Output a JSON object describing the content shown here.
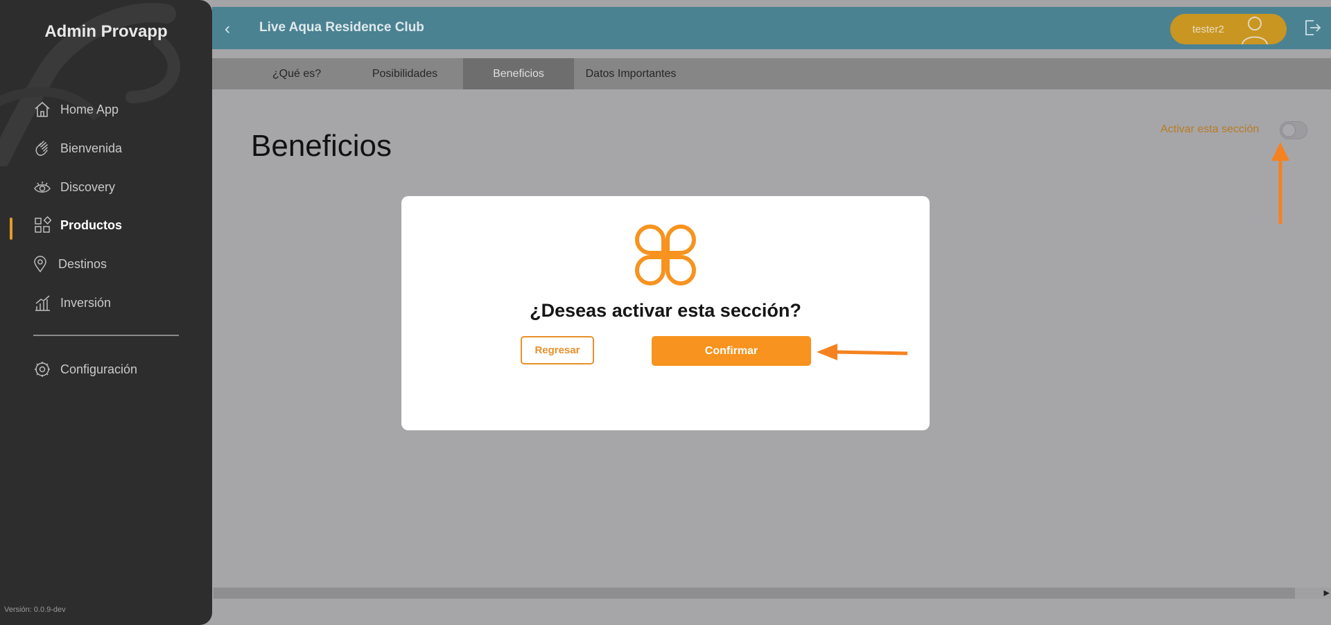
{
  "app": {
    "brand": "Admin Provapp",
    "version": "Versión: 0.0.9-dev"
  },
  "sidebar": {
    "items": [
      {
        "label": "Home App",
        "icon": "home-icon"
      },
      {
        "label": "Bienvenida",
        "icon": "waving-hand-icon"
      },
      {
        "label": "Discovery",
        "icon": "eye-icon"
      },
      {
        "label": "Productos",
        "icon": "grid-shapes-icon",
        "active": true
      },
      {
        "label": "Destinos",
        "icon": "location-pin-icon"
      },
      {
        "label": "Inversión",
        "icon": "bar-chart-icon"
      },
      {
        "label": "Configuración",
        "icon": "settings-icon"
      }
    ]
  },
  "header": {
    "title": "Live Aqua Residence Club",
    "user": "tester2"
  },
  "tabs": [
    {
      "label": "¿Qué es?"
    },
    {
      "label": "Posibilidades"
    },
    {
      "label": "Beneficios",
      "active": true
    },
    {
      "label": "Datos Importantes"
    }
  ],
  "content": {
    "title": "Beneficios",
    "toggle_label": "Activar esta sección",
    "toggle_on": false
  },
  "modal": {
    "question": "¿Deseas activar esta sección?",
    "back_label": "Regresar",
    "confirm_label": "Confirmar"
  },
  "colors": {
    "accent": "#f7931e",
    "header": "#4b8292",
    "sidebar": "#2d2d2e",
    "overlay": "#a6a6a9"
  }
}
